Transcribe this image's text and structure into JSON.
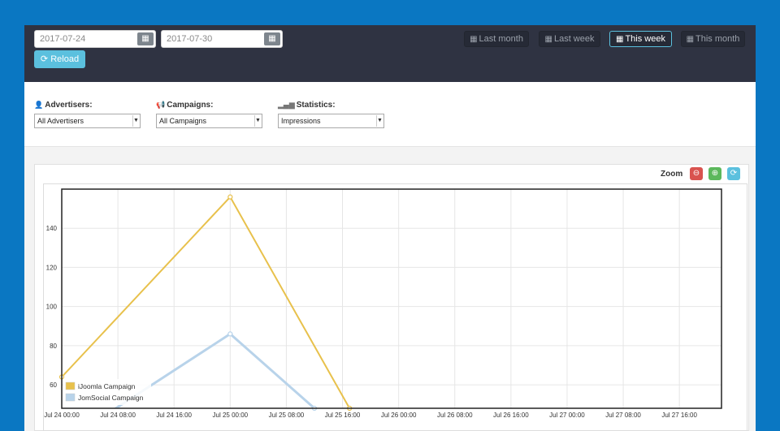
{
  "toolbar": {
    "date_from": "2017-07-24",
    "date_to": "2017-07-30",
    "reload_label": "Reload",
    "ranges": [
      {
        "label": "Last month",
        "active": false
      },
      {
        "label": "Last week",
        "active": false
      },
      {
        "label": "This week",
        "active": true
      },
      {
        "label": "This month",
        "active": false
      }
    ]
  },
  "filters": {
    "advertisers": {
      "label": "Advertisers:",
      "value": "All Advertisers"
    },
    "campaigns": {
      "label": "Campaigns:",
      "value": "All Campaigns"
    },
    "statistics": {
      "label": "Statistics:",
      "value": "Impressions"
    }
  },
  "zoom": {
    "label": "Zoom"
  },
  "colors": {
    "topbar": "#2f3342",
    "accent": "#5bc0de",
    "zoom_out": "#d9534f",
    "zoom_in": "#5cb85c",
    "zoom_reset": "#5bc0de",
    "series_1": "#e8c14c",
    "series_2": "#b8d3ea"
  },
  "chart_data": {
    "type": "line",
    "x_tick_labels": [
      "Jul 24 00:00",
      "Jul 24 08:00",
      "Jul 24 16:00",
      "Jul 25 00:00",
      "Jul 25 08:00",
      "Jul 25 16:00",
      "Jul 26 00:00",
      "Jul 26 08:00",
      "Jul 26 16:00",
      "Jul 27 00:00",
      "Jul 27 08:00",
      "Jul 27 16:00"
    ],
    "y_ticks": [
      60,
      80,
      100,
      120,
      140
    ],
    "ylim": [
      48,
      160
    ],
    "xlim_hours": [
      0,
      94
    ],
    "grid": true,
    "legend_position": "bottom-left",
    "series": [
      {
        "name": "iJoomla Campaign",
        "x_hours": [
          0,
          24,
          41
        ],
        "values": [
          64,
          156,
          48
        ]
      },
      {
        "name": "JomSocial Campaign",
        "x_hours": [
          0,
          24,
          36
        ],
        "values": [
          30,
          86,
          48
        ]
      }
    ]
  }
}
